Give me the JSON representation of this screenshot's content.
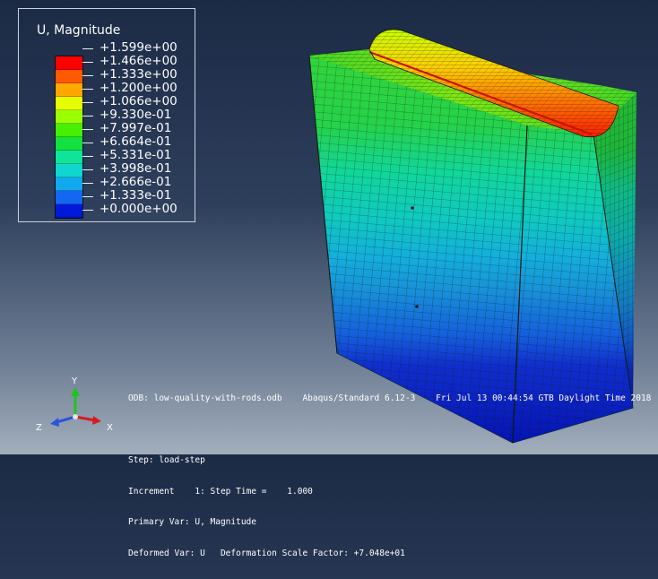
{
  "legend": {
    "title": "U, Magnitude",
    "entries": [
      {
        "label": "+1.599e+00",
        "color": "#ff0000"
      },
      {
        "label": "+1.466e+00",
        "color": "#ff5a00"
      },
      {
        "label": "+1.333e+00",
        "color": "#ffa800"
      },
      {
        "label": "+1.200e+00",
        "color": "#e6ff00"
      },
      {
        "label": "+1.066e+00",
        "color": "#9aff00"
      },
      {
        "label": "+9.330e-01",
        "color": "#46f000"
      },
      {
        "label": "+7.997e-01",
        "color": "#14e042"
      },
      {
        "label": "+6.664e-01",
        "color": "#0fe59a"
      },
      {
        "label": "+5.331e-01",
        "color": "#10d6d0"
      },
      {
        "label": "+3.998e-01",
        "color": "#11a8ee"
      },
      {
        "label": "+2.666e-01",
        "color": "#1467f0"
      },
      {
        "label": "+1.333e-01",
        "color": "#1430ea"
      },
      {
        "label": "+0.000e+00",
        "color": null
      }
    ],
    "band_colors": [
      "#ff0000",
      "#ff5a00",
      "#ffa800",
      "#e6ff00",
      "#9aff00",
      "#46f000",
      "#14e042",
      "#0fe59a",
      "#10d6d0",
      "#11a8ee",
      "#1467f0",
      "#0019d8"
    ]
  },
  "triad": {
    "x_label": "X",
    "y_label": "Y",
    "z_label": "Z"
  },
  "info": {
    "line1": "ODB: low-quality-with-rods.odb    Abaqus/Standard 6.12-3    Fri Jul 13 00:44:54 GTB Daylight Time 2018",
    "line2": "Step: load-step",
    "line3": "Increment    1: Step Time =    1.000",
    "line4": "Primary Var: U, Magnitude",
    "line5": "Deformed Var: U   Deformation Scale Factor: +7.048e+01"
  }
}
